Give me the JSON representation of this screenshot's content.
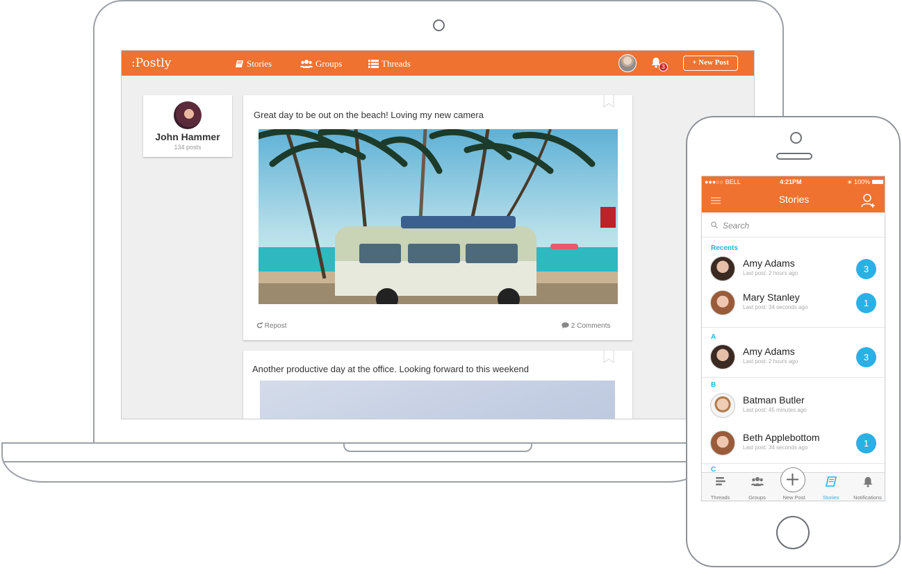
{
  "laptop": {
    "nav": {
      "logo": ":Postly",
      "items": [
        {
          "label": "Stories",
          "icon": "book-icon"
        },
        {
          "label": "Groups",
          "icon": "users-icon"
        },
        {
          "label": "Threads",
          "icon": "list-icon"
        }
      ],
      "notification_count": "3",
      "new_post_label": "New Post"
    },
    "profile": {
      "name": "John Hammer",
      "posts": "134 posts"
    },
    "posts": [
      {
        "text": "Great day to be out on the beach! Loving my new camera",
        "repost_label": "Repost",
        "comments_label": "2 Comments"
      },
      {
        "text": "Another productive day at the office. Looking forward to this weekend"
      }
    ]
  },
  "phone": {
    "status": {
      "carrier": "●●●○○ BELL",
      "time": "4:21PM",
      "battery": "100%"
    },
    "title": "Stories",
    "search_placeholder": "Search",
    "sections": {
      "recents": "Recents",
      "a": "A",
      "b": "B",
      "c": "C"
    },
    "rows": [
      {
        "name": "Amy Adams",
        "sub": "Last post: 2 hours ago",
        "badge": "3"
      },
      {
        "name": "Mary Stanley",
        "sub": "Last post: 34 seconds ago",
        "badge": "1"
      },
      {
        "name": "Amy Adams",
        "sub": "Last post: 2 hours ago",
        "badge": "3"
      },
      {
        "name": "Batman Butler",
        "sub": "Last post: 45 minutes ago",
        "badge": ""
      },
      {
        "name": "Beth Applebottom",
        "sub": "Last post: 34 seconds ago",
        "badge": "1"
      }
    ],
    "tabs": [
      {
        "label": "Threads",
        "icon": "threads-icon"
      },
      {
        "label": "Groups",
        "icon": "groups-icon"
      },
      {
        "label": "New Post",
        "icon": "plus-icon"
      },
      {
        "label": "Stories",
        "icon": "stories-icon",
        "active": true
      },
      {
        "label": "Notifications",
        "icon": "bell-icon"
      }
    ],
    "colors": {
      "accent": "#f07231",
      "blue": "#2ab0e4"
    }
  }
}
